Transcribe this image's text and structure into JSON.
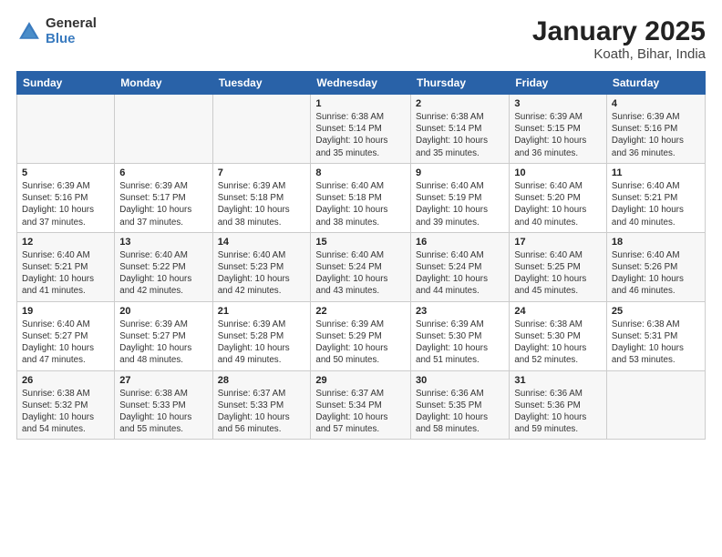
{
  "logo": {
    "general": "General",
    "blue": "Blue"
  },
  "title": "January 2025",
  "subtitle": "Koath, Bihar, India",
  "days_of_week": [
    "Sunday",
    "Monday",
    "Tuesday",
    "Wednesday",
    "Thursday",
    "Friday",
    "Saturday"
  ],
  "weeks": [
    [
      {
        "day": "",
        "info": ""
      },
      {
        "day": "",
        "info": ""
      },
      {
        "day": "",
        "info": ""
      },
      {
        "day": "1",
        "info": "Sunrise: 6:38 AM\nSunset: 5:14 PM\nDaylight: 10 hours\nand 35 minutes."
      },
      {
        "day": "2",
        "info": "Sunrise: 6:38 AM\nSunset: 5:14 PM\nDaylight: 10 hours\nand 35 minutes."
      },
      {
        "day": "3",
        "info": "Sunrise: 6:39 AM\nSunset: 5:15 PM\nDaylight: 10 hours\nand 36 minutes."
      },
      {
        "day": "4",
        "info": "Sunrise: 6:39 AM\nSunset: 5:16 PM\nDaylight: 10 hours\nand 36 minutes."
      }
    ],
    [
      {
        "day": "5",
        "info": "Sunrise: 6:39 AM\nSunset: 5:16 PM\nDaylight: 10 hours\nand 37 minutes."
      },
      {
        "day": "6",
        "info": "Sunrise: 6:39 AM\nSunset: 5:17 PM\nDaylight: 10 hours\nand 37 minutes."
      },
      {
        "day": "7",
        "info": "Sunrise: 6:39 AM\nSunset: 5:18 PM\nDaylight: 10 hours\nand 38 minutes."
      },
      {
        "day": "8",
        "info": "Sunrise: 6:40 AM\nSunset: 5:18 PM\nDaylight: 10 hours\nand 38 minutes."
      },
      {
        "day": "9",
        "info": "Sunrise: 6:40 AM\nSunset: 5:19 PM\nDaylight: 10 hours\nand 39 minutes."
      },
      {
        "day": "10",
        "info": "Sunrise: 6:40 AM\nSunset: 5:20 PM\nDaylight: 10 hours\nand 40 minutes."
      },
      {
        "day": "11",
        "info": "Sunrise: 6:40 AM\nSunset: 5:21 PM\nDaylight: 10 hours\nand 40 minutes."
      }
    ],
    [
      {
        "day": "12",
        "info": "Sunrise: 6:40 AM\nSunset: 5:21 PM\nDaylight: 10 hours\nand 41 minutes."
      },
      {
        "day": "13",
        "info": "Sunrise: 6:40 AM\nSunset: 5:22 PM\nDaylight: 10 hours\nand 42 minutes."
      },
      {
        "day": "14",
        "info": "Sunrise: 6:40 AM\nSunset: 5:23 PM\nDaylight: 10 hours\nand 42 minutes."
      },
      {
        "day": "15",
        "info": "Sunrise: 6:40 AM\nSunset: 5:24 PM\nDaylight: 10 hours\nand 43 minutes."
      },
      {
        "day": "16",
        "info": "Sunrise: 6:40 AM\nSunset: 5:24 PM\nDaylight: 10 hours\nand 44 minutes."
      },
      {
        "day": "17",
        "info": "Sunrise: 6:40 AM\nSunset: 5:25 PM\nDaylight: 10 hours\nand 45 minutes."
      },
      {
        "day": "18",
        "info": "Sunrise: 6:40 AM\nSunset: 5:26 PM\nDaylight: 10 hours\nand 46 minutes."
      }
    ],
    [
      {
        "day": "19",
        "info": "Sunrise: 6:40 AM\nSunset: 5:27 PM\nDaylight: 10 hours\nand 47 minutes."
      },
      {
        "day": "20",
        "info": "Sunrise: 6:39 AM\nSunset: 5:27 PM\nDaylight: 10 hours\nand 48 minutes."
      },
      {
        "day": "21",
        "info": "Sunrise: 6:39 AM\nSunset: 5:28 PM\nDaylight: 10 hours\nand 49 minutes."
      },
      {
        "day": "22",
        "info": "Sunrise: 6:39 AM\nSunset: 5:29 PM\nDaylight: 10 hours\nand 50 minutes."
      },
      {
        "day": "23",
        "info": "Sunrise: 6:39 AM\nSunset: 5:30 PM\nDaylight: 10 hours\nand 51 minutes."
      },
      {
        "day": "24",
        "info": "Sunrise: 6:38 AM\nSunset: 5:30 PM\nDaylight: 10 hours\nand 52 minutes."
      },
      {
        "day": "25",
        "info": "Sunrise: 6:38 AM\nSunset: 5:31 PM\nDaylight: 10 hours\nand 53 minutes."
      }
    ],
    [
      {
        "day": "26",
        "info": "Sunrise: 6:38 AM\nSunset: 5:32 PM\nDaylight: 10 hours\nand 54 minutes."
      },
      {
        "day": "27",
        "info": "Sunrise: 6:38 AM\nSunset: 5:33 PM\nDaylight: 10 hours\nand 55 minutes."
      },
      {
        "day": "28",
        "info": "Sunrise: 6:37 AM\nSunset: 5:33 PM\nDaylight: 10 hours\nand 56 minutes."
      },
      {
        "day": "29",
        "info": "Sunrise: 6:37 AM\nSunset: 5:34 PM\nDaylight: 10 hours\nand 57 minutes."
      },
      {
        "day": "30",
        "info": "Sunrise: 6:36 AM\nSunset: 5:35 PM\nDaylight: 10 hours\nand 58 minutes."
      },
      {
        "day": "31",
        "info": "Sunrise: 6:36 AM\nSunset: 5:36 PM\nDaylight: 10 hours\nand 59 minutes."
      },
      {
        "day": "",
        "info": ""
      }
    ]
  ]
}
